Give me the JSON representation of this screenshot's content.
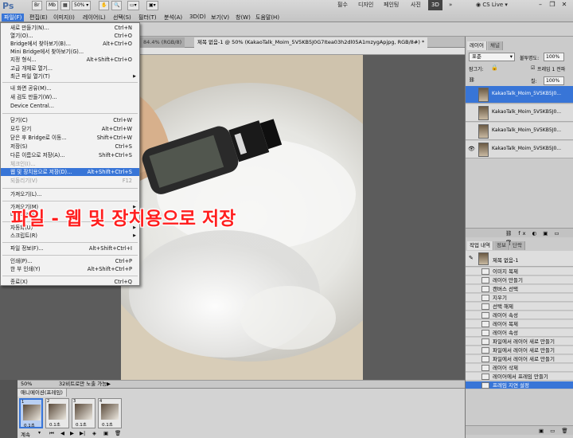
{
  "app": {
    "logo": "Ps"
  },
  "menubar": {
    "items": [
      "파일(F)",
      "편집(E)",
      "이미지(I)",
      "레이어(L)",
      "선택(S)",
      "필터(T)",
      "분석(A)",
      "3D(D)",
      "보기(V)",
      "창(W)",
      "도움말(H)"
    ],
    "zoom": "50%",
    "workspaces": [
      "필수",
      "디자인",
      "페인팅",
      "사진",
      "3D"
    ],
    "cs_live": "CS Live"
  },
  "tabs": [
    "84.4% (RGB/8)",
    "제목 없음-1 @ 50% (KakaoTalk_Moim_5V5KB5J0G7Itea03h2dl05A1mzygApjpg, RGB/8#) *"
  ],
  "file_menu": {
    "items": [
      {
        "label": "새로 만들기(N)...",
        "shortcut": "Ctrl+N"
      },
      {
        "label": "열기(O)...",
        "shortcut": "Ctrl+O"
      },
      {
        "label": "Bridge에서 찾아보기(B)...",
        "shortcut": "Alt+Ctrl+O"
      },
      {
        "label": "Mini Bridge에서 찾아보기(G)...",
        "shortcut": ""
      },
      {
        "label": "지정 형식...",
        "shortcut": "Alt+Shift+Ctrl+O"
      },
      {
        "label": "고급 개체로 열기...",
        "shortcut": ""
      },
      {
        "label": "최근 파일 열기(T)",
        "shortcut": ""
      },
      {
        "label": "내 화면 공유(M)...",
        "shortcut": ""
      },
      {
        "label": "새 검토 만들기(W)...",
        "shortcut": ""
      },
      {
        "label": "Device Central...",
        "shortcut": ""
      },
      {
        "label": "닫기(C)",
        "shortcut": "Ctrl+W"
      },
      {
        "label": "모두 닫기",
        "shortcut": "Alt+Ctrl+W"
      },
      {
        "label": "닫은 후 Bridge로 이동...",
        "shortcut": "Shift+Ctrl+W"
      },
      {
        "label": "저장(S)",
        "shortcut": "Ctrl+S"
      },
      {
        "label": "다른 이름으로 저장(A)...",
        "shortcut": "Shift+Ctrl+S"
      },
      {
        "label": "체크인(I)...",
        "shortcut": ""
      },
      {
        "label": "웹 및 장치용으로 저장(D)...",
        "shortcut": "Alt+Shift+Ctrl+S"
      },
      {
        "label": "되돌리기(V)",
        "shortcut": "F12"
      },
      {
        "label": "가져오기(L)...",
        "shortcut": ""
      },
      {
        "label": "가져오기(M)",
        "shortcut": ""
      },
      {
        "label": "내보내기(E)",
        "shortcut": ""
      },
      {
        "label": "자동화(U)",
        "shortcut": ""
      },
      {
        "label": "스크립트(R)",
        "shortcut": ""
      },
      {
        "label": "파일 정보(F)...",
        "shortcut": "Alt+Shift+Ctrl+I"
      },
      {
        "label": "인쇄(P)...",
        "shortcut": "Ctrl+P"
      },
      {
        "label": "한 부 인쇄(Y)",
        "shortcut": "Alt+Shift+Ctrl+P"
      },
      {
        "label": "종료(X)",
        "shortcut": "Ctrl+Q"
      }
    ]
  },
  "caption": "파일 - 웹 및 장치용으로 저장",
  "status": {
    "zoom": "50%",
    "info": "32비트로만 노출 가능"
  },
  "animation": {
    "title": "애니메이션(프레임)",
    "frames": [
      {
        "num": "1",
        "delay": "0.1초"
      },
      {
        "num": "2",
        "delay": "0.1초"
      },
      {
        "num": "3",
        "delay": "0.1초"
      },
      {
        "num": "4",
        "delay": "0.1초"
      }
    ],
    "loop": "계속"
  },
  "layers_panel": {
    "tabs": [
      "레이어",
      "채널"
    ],
    "blend_mode": "표준",
    "opacity_label": "불투명도:",
    "opacity": "100%",
    "fill_label": "칠:",
    "fill": "100%",
    "unify_label": "프레임 1 전파",
    "lock_label": "잠그기:",
    "layers": [
      {
        "name": "KakaoTalk_Moim_5V5KB5J0..."
      },
      {
        "name": "KakaoTalk_Moim_5V5KB5J0..."
      },
      {
        "name": "KakaoTalk_Moim_5V5KB5J0..."
      },
      {
        "name": "KakaoTalk_Moim_5V5KB5J0..."
      }
    ]
  },
  "history_panel": {
    "tabs": [
      "작업 내역",
      "정보",
      "단락"
    ],
    "snapshot": "제목 없음-1",
    "steps": [
      "이미지 복제",
      "레이어 만들기",
      "캔버스 선택",
      "지우기",
      "선택 해제",
      "레이어 속성",
      "레이어 복제",
      "레이어 속성",
      "파일에서 레이어 새로 만들기",
      "파일에서 레이어 새로 만들기",
      "파일에서 레이어 새로 만들기",
      "레이어 삭제",
      "레이어에서 프레임 만들기",
      "프레임 지연 설정"
    ]
  }
}
